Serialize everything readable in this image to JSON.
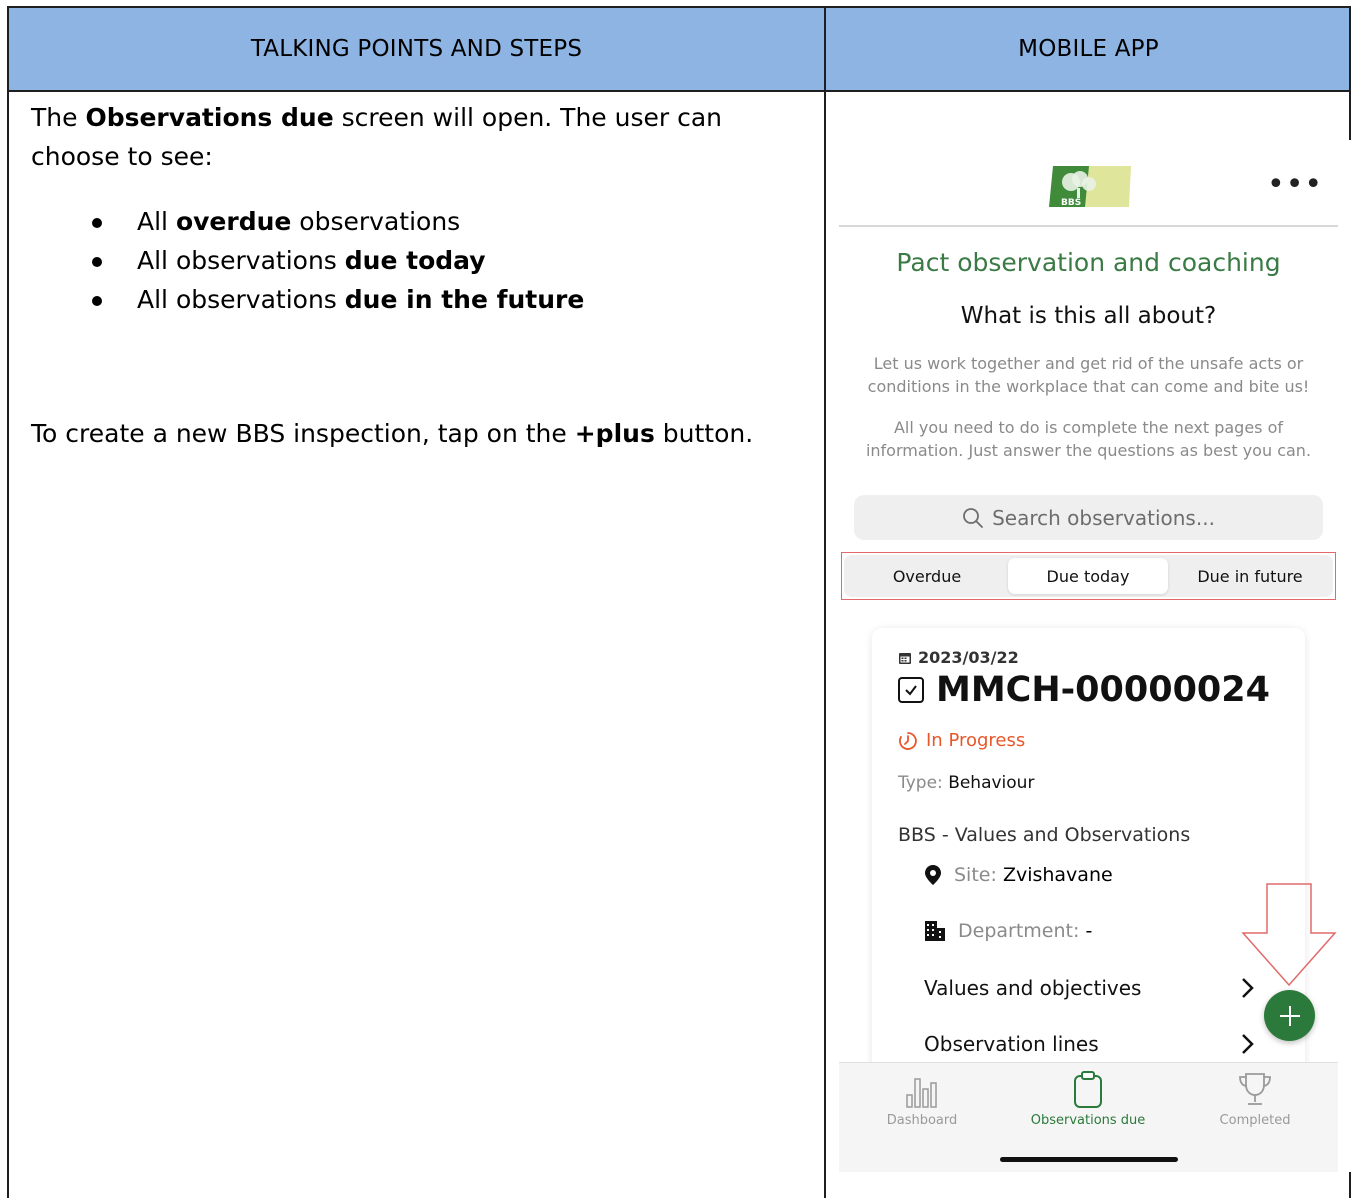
{
  "table": {
    "header_left": "TALKING POINTS AND STEPS",
    "header_right": "MOBILE APP"
  },
  "left": {
    "intro_1": "The ",
    "intro_bold": "Observations due",
    "intro_2": " screen will open. The user can choose to see:",
    "bullets": [
      {
        "pre": "All ",
        "bold": "overdue",
        "post": " observations"
      },
      {
        "pre": "All observations ",
        "bold": "due today",
        "post": ""
      },
      {
        "pre": "All observations ",
        "bold": "due in the future",
        "post": ""
      }
    ],
    "create_1": "To create a new BBS inspection, tap on the ",
    "create_bold": "+plus",
    "create_2": " button."
  },
  "app": {
    "logo_text": "BBS",
    "more_icon": "more-horizontal-icon",
    "title": "Pact observation and coaching",
    "subtitle": "What is this all about?",
    "para1": "Let us work together and get rid of the unsafe acts or conditions in the workplace that can come and bite us!",
    "para2": "All you need to do is complete the next pages of information. Just answer the questions as best you can.",
    "search_placeholder": "Search observations...",
    "tabs": [
      "Overdue",
      "Due today",
      "Due in future"
    ],
    "active_tab": "Due today",
    "card": {
      "date": "2023/03/22",
      "id": "MMCH-00000024",
      "status": "In Progress",
      "type_label": "Type:",
      "type_value": "Behaviour",
      "bbs_title": "BBS - Values and Observations",
      "site_label": "Site:",
      "site_value": "Zvishavane",
      "dept_label": "Department:",
      "dept_value": "-",
      "nav_items": [
        "Values and objectives",
        "Observation lines"
      ]
    },
    "tabbar": [
      {
        "label": "Dashboard",
        "icon": "bar-chart-icon"
      },
      {
        "label": "Observations due",
        "icon": "clipboard-icon"
      },
      {
        "label": "Completed",
        "icon": "trophy-icon"
      }
    ],
    "colors": {
      "accent_green": "#2b7a3b",
      "status_orange": "#e8572a",
      "highlight_red": "#e06a6a",
      "header_blue": "#8eb4e3"
    }
  }
}
